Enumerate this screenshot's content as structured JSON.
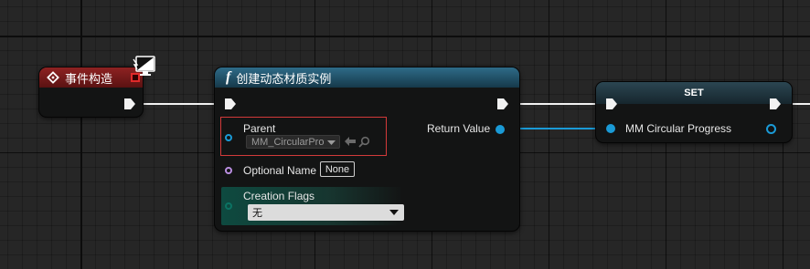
{
  "nodes": {
    "event_construct": {
      "title": "事件构造"
    },
    "create_material": {
      "title": "创建动态材质实例",
      "function_glyph": "f",
      "parent_label": "Parent",
      "parent_value": "MM_CircularProg",
      "optional_name_label": "Optional Name",
      "optional_name_value": "None",
      "creation_flags_label": "Creation Flags",
      "creation_flags_value": "无",
      "return_value_label": "Return Value"
    },
    "set_node": {
      "title": "SET",
      "variable_label": "MM Circular Progress"
    }
  },
  "colors": {
    "event_header": "#7a1a1a",
    "function_header": "#1f4a5e",
    "object_pin": "#1a9ad6",
    "name_pin": "#b98ee0",
    "flags_pin": "#0b7363",
    "selection_highlight": "#d23a3a"
  },
  "icons": {
    "event": "event-diamond-icon",
    "function": "function-f-icon",
    "monitor": "server-client-monitor-icon",
    "use_asset": "arrow-left-icon",
    "browse": "magnifier-icon",
    "dropdown": "chevron-down-icon"
  }
}
